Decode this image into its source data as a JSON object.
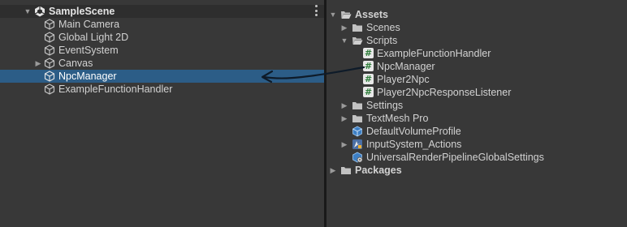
{
  "hierarchy": {
    "scene_name": "SampleScene",
    "items": [
      {
        "label": "Main Camera"
      },
      {
        "label": "Global Light 2D"
      },
      {
        "label": "EventSystem"
      },
      {
        "label": "Canvas"
      },
      {
        "label": "NpcManager"
      },
      {
        "label": "ExampleFunctionHandler"
      }
    ]
  },
  "project": {
    "assets_label": "Assets",
    "scenes_label": "Scenes",
    "scripts_label": "Scripts",
    "scripts": [
      {
        "label": "ExampleFunctionHandler"
      },
      {
        "label": "NpcManager"
      },
      {
        "label": "Player2Npc"
      },
      {
        "label": "Player2NpcResponseListener"
      }
    ],
    "settings_label": "Settings",
    "textmesh_label": "TextMesh Pro",
    "volume_profile_label": "DefaultVolumeProfile",
    "input_actions_label": "InputSystem_Actions",
    "urp_settings_label": "UniversalRenderPipelineGlobalSettings",
    "packages_label": "Packages"
  },
  "colors": {
    "panel_bg": "#383838",
    "selection": "#2c5d87",
    "divider": "#191919",
    "script_hash": "#2f7d3b",
    "annotation_stroke": "#0e1b29"
  },
  "annotation": {
    "type": "hand-drawn-arrow",
    "from": "NpcManager script",
    "to": "NpcManager object"
  }
}
